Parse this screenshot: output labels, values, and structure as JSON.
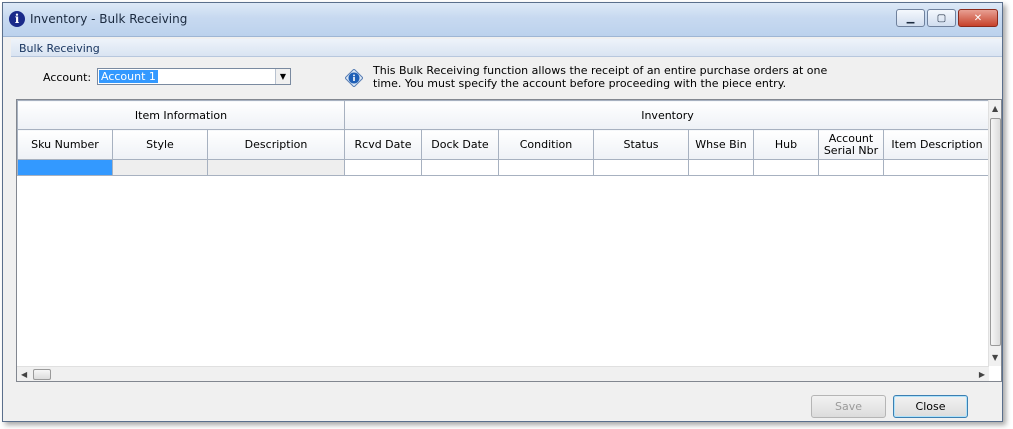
{
  "window": {
    "title": "Inventory - Bulk Receiving",
    "icon": "info-icon",
    "controls": [
      "minimize-icon",
      "maximize-icon",
      "close-icon"
    ]
  },
  "group": {
    "label": "Bulk Receiving"
  },
  "account": {
    "label": "Account:",
    "value": "Account 1"
  },
  "info": {
    "text": "This Bulk Receiving function allows the receipt of an entire purchase orders at one time.  You must specify the account before proceeding with the piece entry."
  },
  "grid": {
    "groups": [
      "Item Information",
      "Inventory"
    ],
    "columns": [
      "Sku Number",
      "Style",
      "Description",
      "Rcvd Date",
      "Dock Date",
      "Condition",
      "Status",
      "Whse Bin",
      "Hub",
      "Account Serial Nbr",
      "Item Description"
    ]
  },
  "buttons": {
    "save": "Save",
    "close": "Close"
  },
  "colors": {
    "selection": "#3399ff",
    "title_gradient": "#c7d9f0",
    "close_button": "#c7412a"
  }
}
